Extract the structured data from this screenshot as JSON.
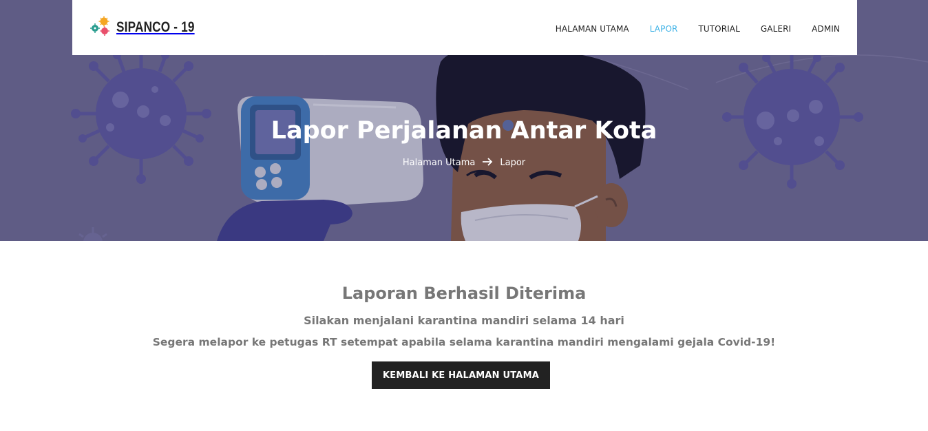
{
  "brand": {
    "name": "SIPANCO - 19",
    "logo_icon": "virus-cluster-icon",
    "colors": [
      "#f5a623",
      "#e94f6b",
      "#2a9d8f"
    ]
  },
  "nav": {
    "items": [
      {
        "label": "HALAMAN UTAMA",
        "active": false
      },
      {
        "label": "LAPOR",
        "active": true
      },
      {
        "label": "TUTORIAL",
        "active": false
      },
      {
        "label": "GALERI",
        "active": false
      },
      {
        "label": "ADMIN",
        "active": false
      }
    ],
    "active_color": "#3db2e6"
  },
  "hero": {
    "title": "Lapor Perjalanan Antar Kota",
    "breadcrumb": {
      "home": "Halaman Utama",
      "separator_icon": "arrow-right-icon",
      "current": "Lapor"
    },
    "background_color": "#6d6a92"
  },
  "content": {
    "title": "Laporan Berhasil Diterima",
    "message_1": "Silakan menjalani karantina mandiri selama 14 hari",
    "message_2": "Segera melapor ke petugas RT setempat apabila selama karantina mandiri mengalami gejala Covid-19!",
    "button_label": "KEMBALI KE HALAMAN UTAMA"
  }
}
